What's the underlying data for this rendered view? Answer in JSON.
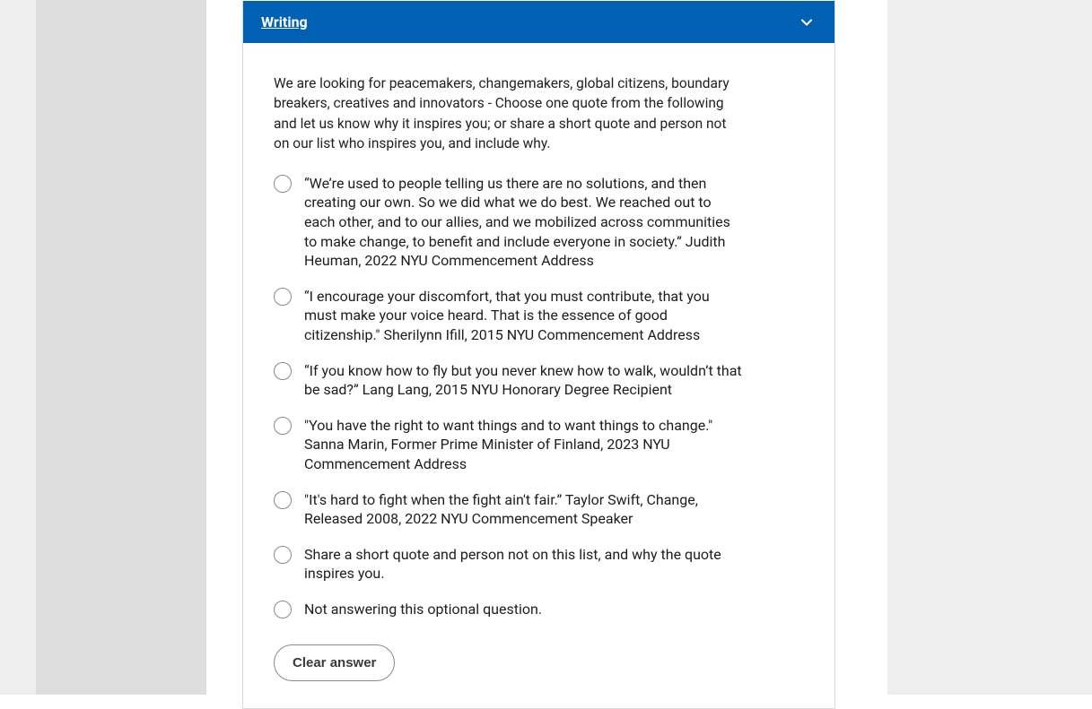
{
  "header": {
    "title": "Writing"
  },
  "prompt": "We are looking for peacemakers, changemakers, global citizens, boundary breakers, creatives and innovators - Choose one quote from the following and let us know why it inspires you; or share a short quote and person not on our list who inspires you, and include why.",
  "options": [
    "“We’re used to people telling us there are no solutions, and then creating our own. So we did what we do best. We reached out to each other, and to our allies, and we mobilized across communities to make change, to benefit and include everyone in society.” Judith Heuman, 2022 NYU Commencement Address",
    "“I encourage your discomfort, that you must contribute, that you must make your voice heard. That is the essence of good citizenship.\" Sherilynn Ifill, 2015 NYU Commencement Address",
    "“If you know how to fly but you never knew how to walk, wouldn’t that be sad?” Lang Lang, 2015 NYU Honorary Degree Recipient",
    "\"You have the right to want things and to want things to change.\" Sanna Marin, Former Prime Minister of Finland, 2023 NYU Commencement Address",
    "\"It's hard to fight when the fight ain't fair.” Taylor Swift, Change, Released 2008, 2022 NYU Commencement Speaker",
    "Share a short quote and person not on this list, and why the quote inspires you.",
    "Not answering this optional question."
  ],
  "actions": {
    "clear_label": "Clear answer"
  },
  "colors": {
    "header_bg": "#0061b2"
  }
}
